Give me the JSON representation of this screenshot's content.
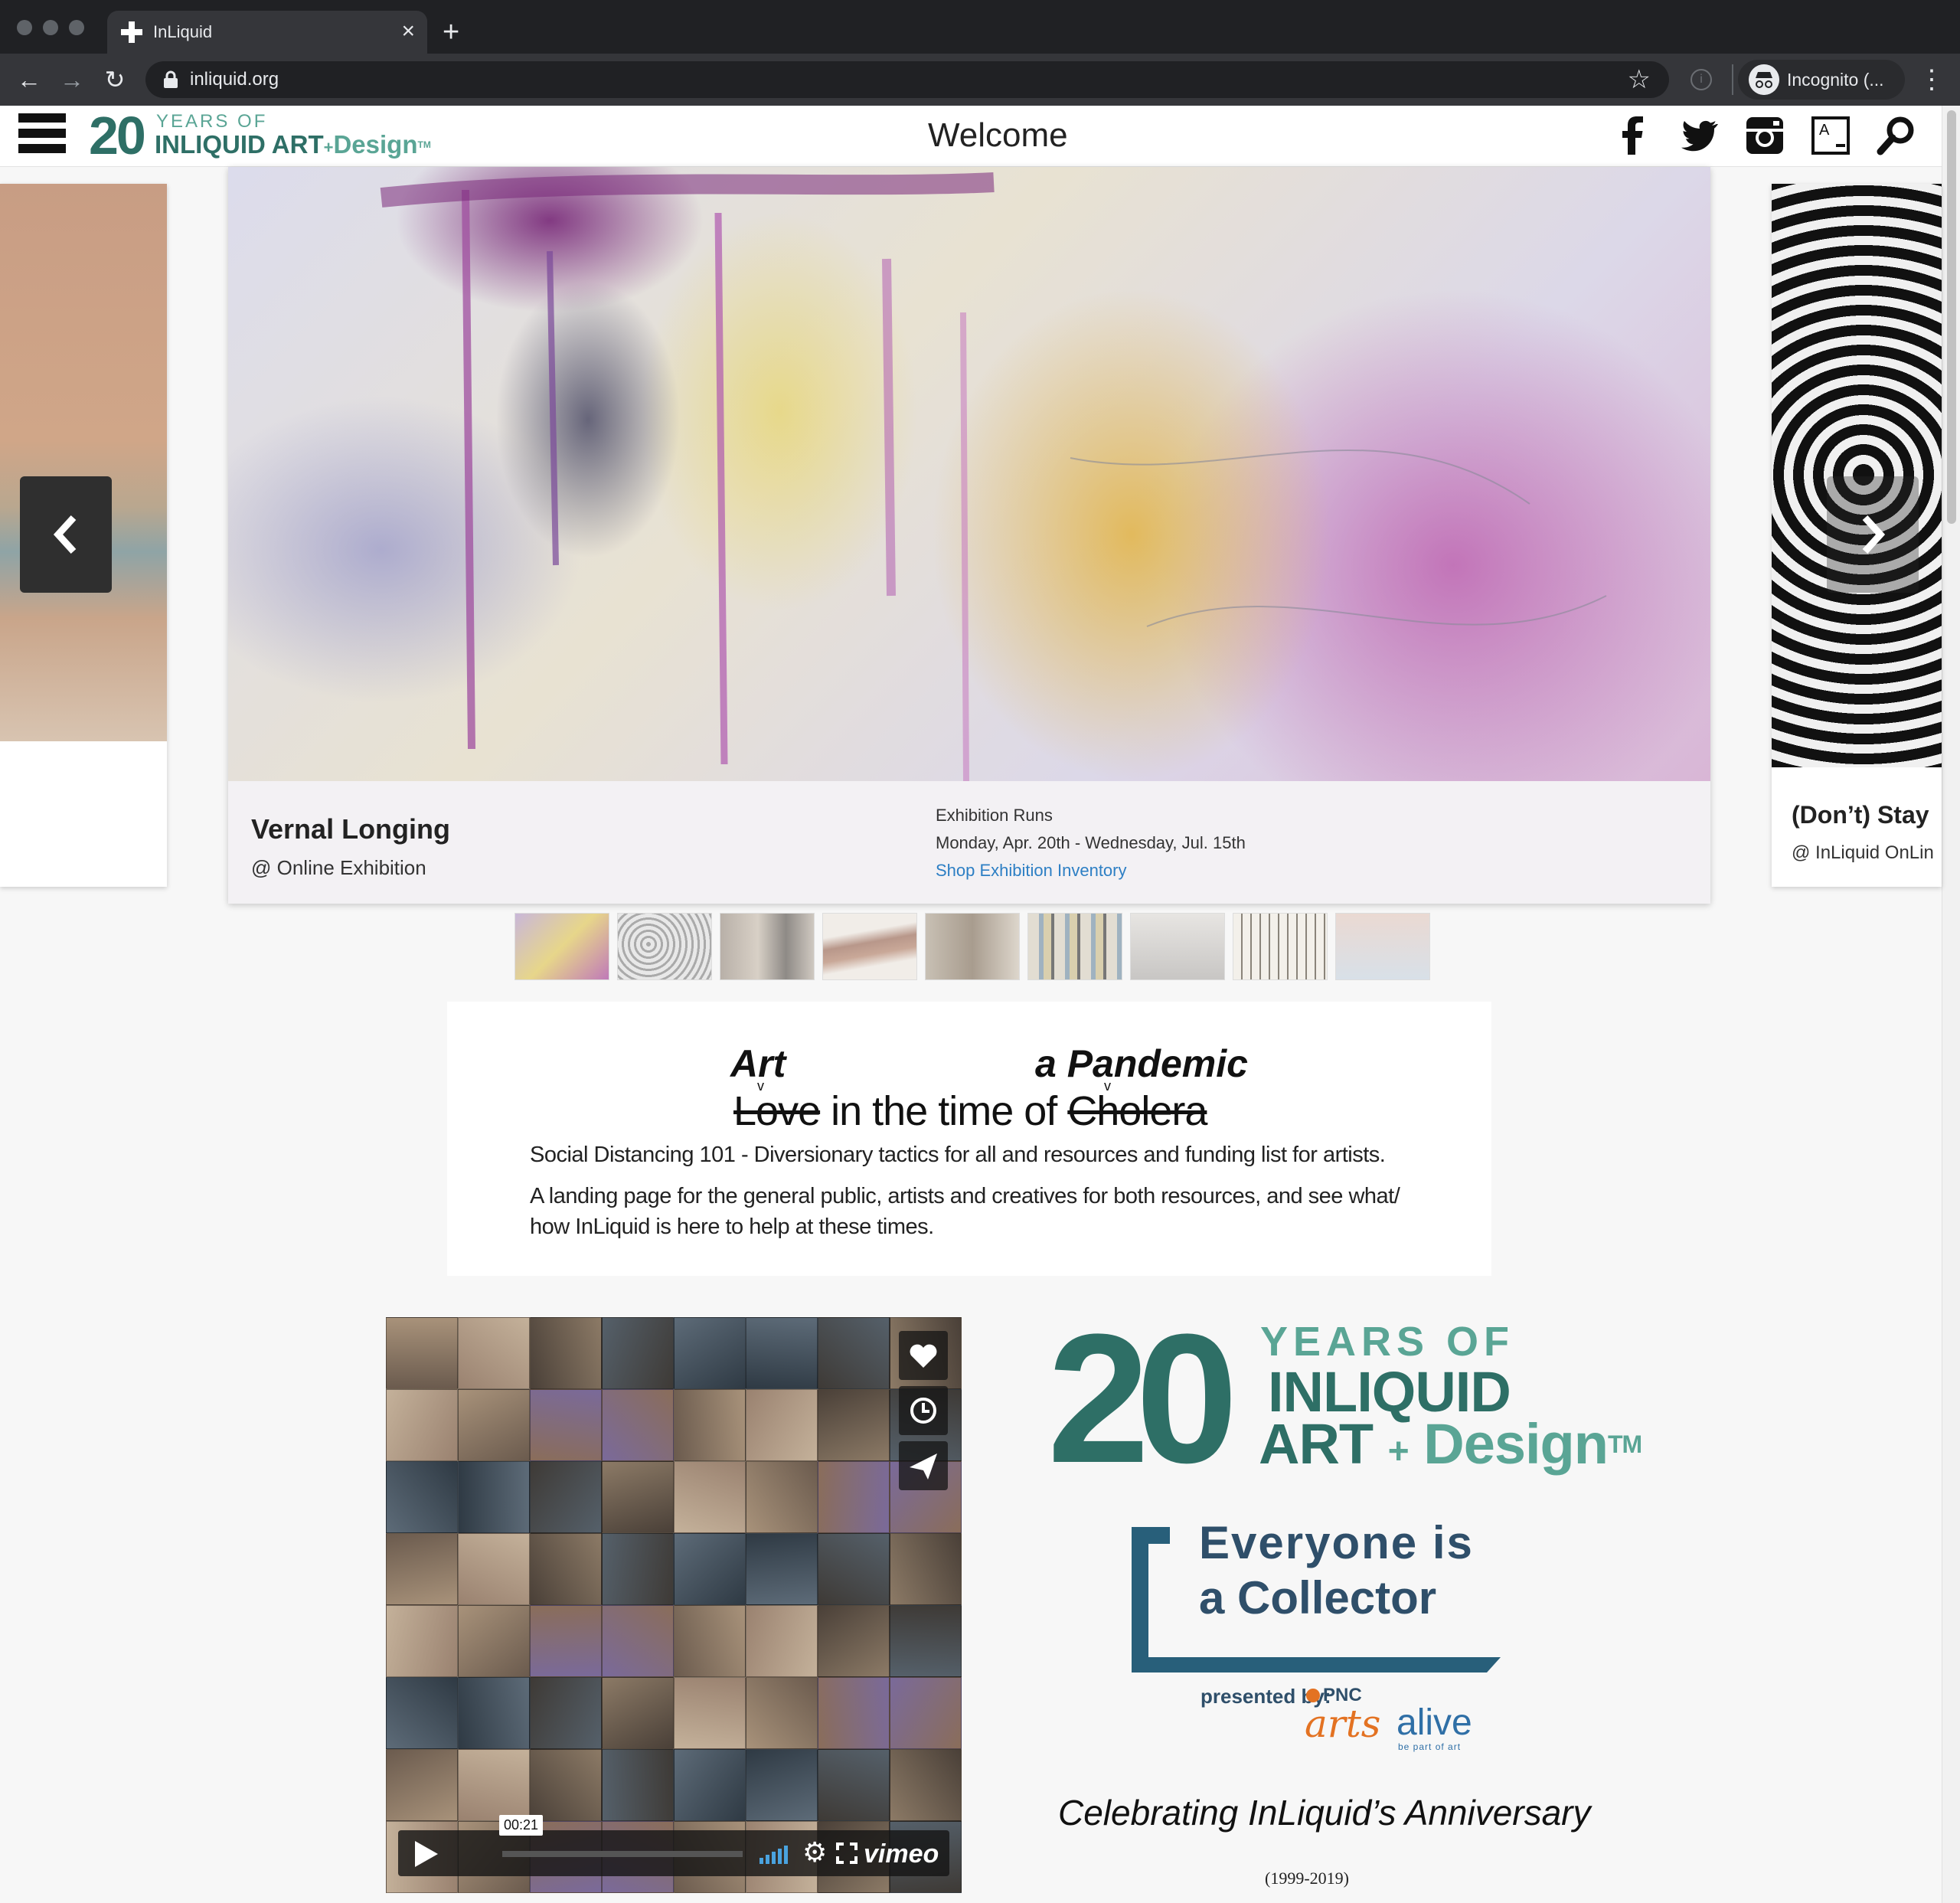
{
  "browser": {
    "tab_title": "InLiquid",
    "tab_close": "×",
    "new_tab": "+",
    "url": "inliquid.org",
    "profile_label": "Incognito (...",
    "icons": [
      "back-icon",
      "forward-icon",
      "reload-icon",
      "lock-icon",
      "star-icon",
      "extension-icon",
      "incognito-icon",
      "kebab-menu-icon"
    ]
  },
  "header": {
    "logo_number": "20",
    "logo_years": "YEARS OF",
    "logo_inliquid": "INLIQUID",
    "logo_art": "ART",
    "logo_plus": "+",
    "logo_design": "Design",
    "logo_tm": "TM",
    "title": "Welcome",
    "icons": [
      "facebook-icon",
      "twitter-icon",
      "instagram-icon",
      "artsy-icon",
      "search-icon"
    ],
    "brand_color": "#2e6f66",
    "accent_color": "#5aa595"
  },
  "carousel": {
    "current": {
      "title": "Vernal Longing",
      "venue": "@ Online Exhibition",
      "runs_label": "Exhibition Runs",
      "runs_dates": "Monday, Apr. 20th - Wednesday, Jul. 15th",
      "shop_link": "Shop Exhibition Inventory"
    },
    "next": {
      "title": "(Don’t) Stay",
      "venue": "@ InLiquid OnLin"
    },
    "thumbnail_count": 9
  },
  "pandemic": {
    "art": "Art",
    "caret": "v",
    "a_pandemic": "a Pandemic",
    "love": "Love",
    "in_the_time_of": " in the time of ",
    "cholera": "Cholera",
    "line1": "Social Distancing 101  - Diversionary tactics for all and resources and funding list for artists.",
    "line2": "A landing page for the general public, artists and creatives for both resources, and see what/ how InLiquid is here to help at these times."
  },
  "video": {
    "time": "00:21",
    "provider": "vimeo",
    "icons": [
      "heart-icon",
      "clock-icon",
      "send-icon",
      "play-icon",
      "volume-icon",
      "settings-icon",
      "fullscreen-icon"
    ]
  },
  "anniversary": {
    "number": "20",
    "years_of": "YEARS OF",
    "inliquid": "INLIQUID",
    "art": "ART",
    "plus": "+",
    "design": "Design",
    "tm": "TM",
    "collector_line1": "Everyone is",
    "collector_line2": "a Collector",
    "presented_by": "presented by:",
    "pnc": "PNC",
    "arts": "arts",
    "alive": "alive",
    "be_part_of_art": "be part of art",
    "celebrating": "Celebrating InLiquid’s Anniversary",
    "years_range": "(1999-2019)"
  }
}
